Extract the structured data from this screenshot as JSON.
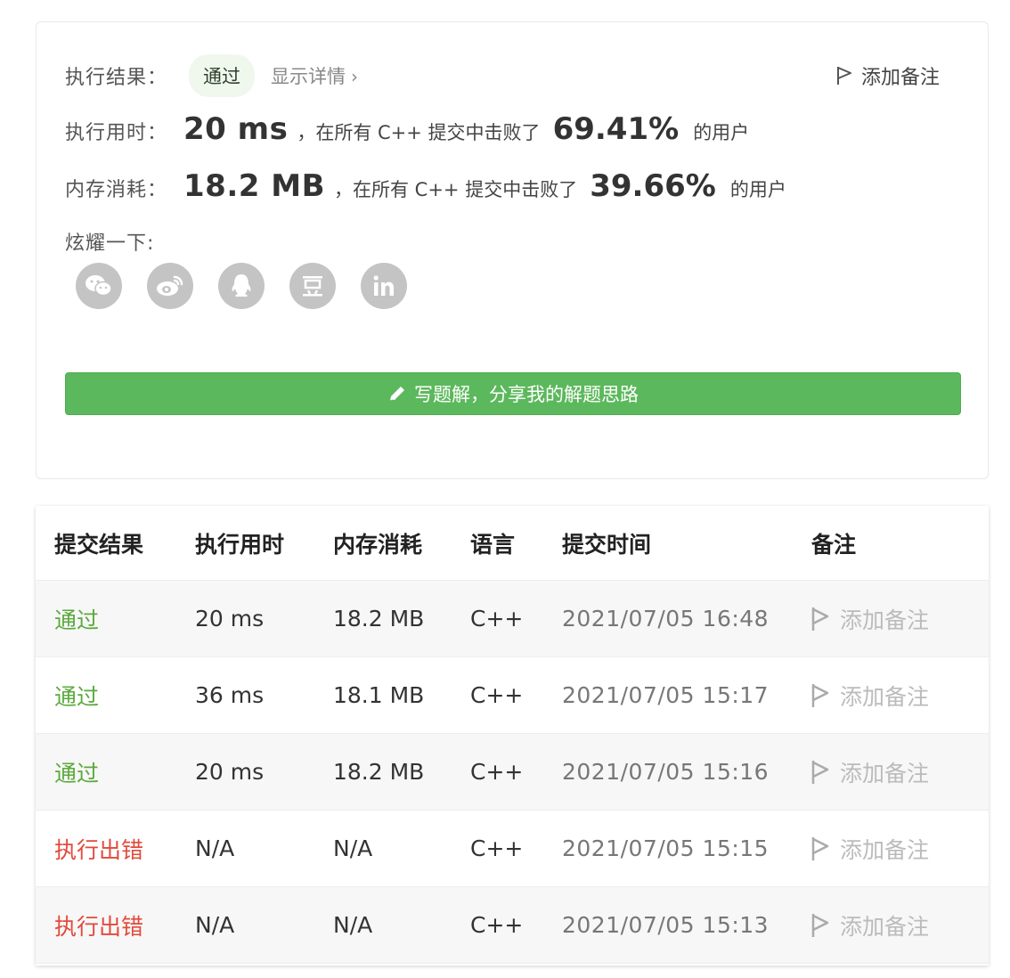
{
  "summary": {
    "result_label": "执行结果：",
    "result_status": "通过",
    "show_details": "显示详情",
    "add_note": "添加备注",
    "runtime_label": "执行用时：",
    "runtime_value": "20 ms",
    "runtime_text": "，在所有 C++ 提交中击败了",
    "runtime_pct": "69.41%",
    "runtime_suffix": "的用户",
    "memory_label": "内存消耗：",
    "memory_value": "18.2 MB",
    "memory_text": "，在所有 C++ 提交中击败了",
    "memory_pct": "39.66%",
    "memory_suffix": "的用户",
    "share_label": "炫耀一下:",
    "share_icons": [
      "wechat-icon",
      "weibo-icon",
      "qq-icon",
      "douban-icon",
      "linkedin-icon"
    ],
    "write_solution": "写题解，分享我的解题思路",
    "accent_color": "#5cb85c"
  },
  "table": {
    "headers": [
      "提交结果",
      "执行用时",
      "内存消耗",
      "语言",
      "提交时间",
      "备注"
    ],
    "rows": [
      {
        "status": "通过",
        "status_type": "pass",
        "runtime": "20 ms",
        "memory": "18.2 MB",
        "lang": "C++",
        "time": "2021/07/05 16:48",
        "note": "添加备注"
      },
      {
        "status": "通过",
        "status_type": "pass",
        "runtime": "36 ms",
        "memory": "18.1 MB",
        "lang": "C++",
        "time": "2021/07/05 15:17",
        "note": "添加备注"
      },
      {
        "status": "通过",
        "status_type": "pass",
        "runtime": "20 ms",
        "memory": "18.2 MB",
        "lang": "C++",
        "time": "2021/07/05 15:16",
        "note": "添加备注"
      },
      {
        "status": "执行出错",
        "status_type": "err",
        "runtime": "N/A",
        "memory": "N/A",
        "lang": "C++",
        "time": "2021/07/05 15:15",
        "note": "添加备注"
      },
      {
        "status": "执行出错",
        "status_type": "err",
        "runtime": "N/A",
        "memory": "N/A",
        "lang": "C++",
        "time": "2021/07/05 15:13",
        "note": "添加备注"
      }
    ],
    "pass_color": "#5aaa3c",
    "error_color": "#e24a3c"
  }
}
